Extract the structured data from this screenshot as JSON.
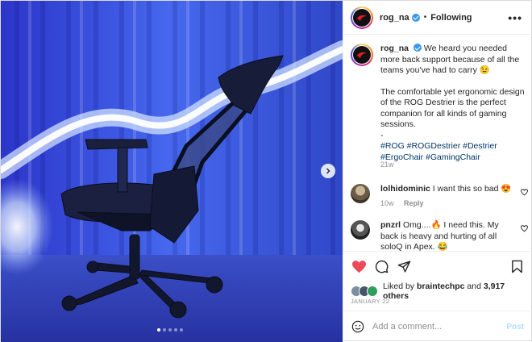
{
  "header": {
    "username": "rog_na",
    "separator": "•",
    "follow_label": "Following",
    "more_label": "•••"
  },
  "caption": {
    "username": "rog_na",
    "line1": "We heard you needed more back support because of all the teams you've had to carry 😉",
    "line2": "The comfortable yet ergonomic design of the ROG Destrier is the perfect companion for all kinds of gaming sessions.",
    "dash": "-",
    "hashtags": "#ROG #ROGDestrier #Destrier #ErgoChair #GamingChair",
    "time_ago": "21w"
  },
  "comments": [
    {
      "username": "lolhidominic",
      "text": "I want this so bad 😍",
      "time": "10w",
      "reply_label": "Reply"
    },
    {
      "username": "pnzrl",
      "text": "Omg....🔥 I need this. My back is heavy and hurting of all soloQ in Apex. 😂",
      "time": "",
      "reply_label": ""
    }
  ],
  "likes": {
    "prefix": "Liked by",
    "user": "braintechpc",
    "connector": "and",
    "others": "3,917 others"
  },
  "date": "JANUARY 22",
  "add_comment": {
    "placeholder": "Add a comment...",
    "post_label": "Post"
  },
  "carousel": {
    "slide_count": 5,
    "active_index": 0
  },
  "colors": {
    "verified": "#3897f0",
    "like_heart": "#ed4956",
    "link": "#00376b",
    "post_disabled": "#b2dffc"
  }
}
